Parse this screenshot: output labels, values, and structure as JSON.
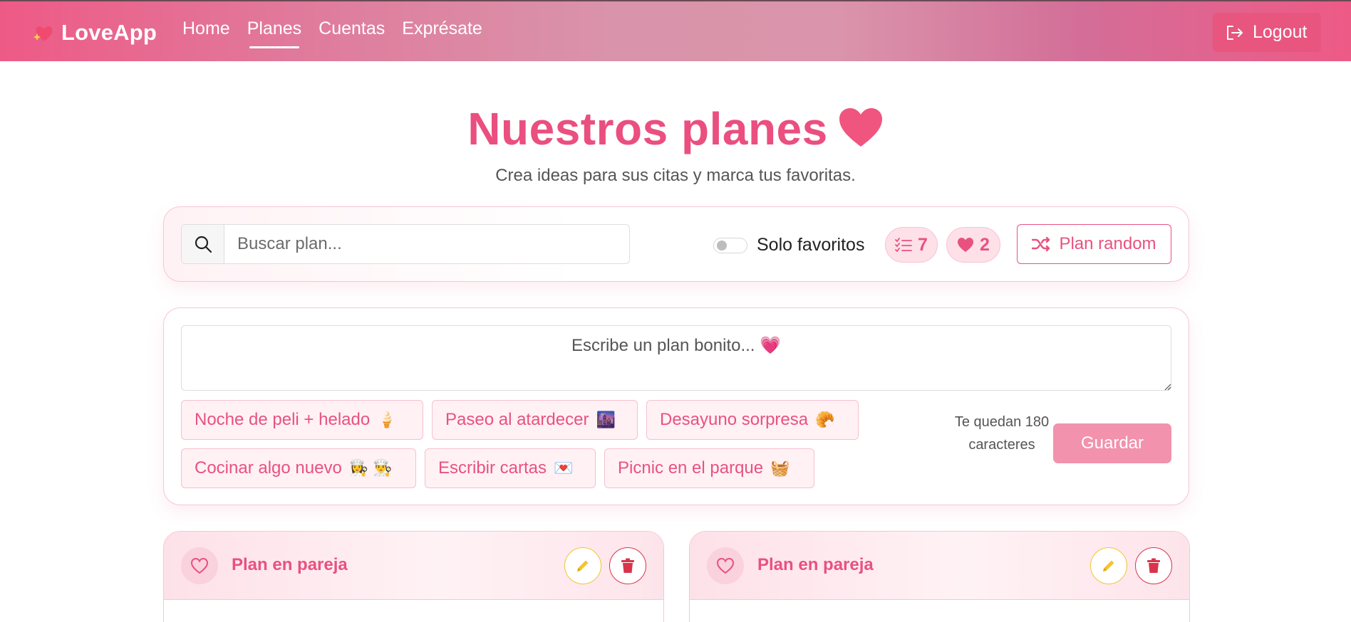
{
  "nav": {
    "brand": "LoveApp",
    "links": [
      "Home",
      "Planes",
      "Cuentas",
      "Exprésate"
    ],
    "active_link": "Planes",
    "logout_label": "Logout"
  },
  "header": {
    "title": "Nuestros planes",
    "subtitle": "Crea ideas para sus citas y marca tus favoritas."
  },
  "filters": {
    "search_placeholder": "Buscar plan...",
    "favorites_toggle_label": "Solo favoritos",
    "favorites_toggle_on": false,
    "plan_count": "7",
    "favorite_count": "2",
    "random_label": "Plan random"
  },
  "composer": {
    "placeholder": "Escribe un plan bonito... 💗",
    "suggestions": [
      {
        "label": "Noche de peli + helado",
        "emoji": "🍦"
      },
      {
        "label": "Paseo al atardecer",
        "emoji": "🌆"
      },
      {
        "label": "Desayuno sorpresa",
        "emoji": "🥐"
      },
      {
        "label": "Cocinar algo nuevo",
        "emoji": "👩‍🍳 👨‍🍳"
      },
      {
        "label": "Escribir cartas",
        "emoji": "💌"
      },
      {
        "label": "Picnic en el parque",
        "emoji": "🧺"
      }
    ],
    "remaining_text": "Te quedan 180 caracteres",
    "save_label": "Guardar"
  },
  "plans": [
    {
      "title": "Plan en pareja"
    },
    {
      "title": "Plan en pareja"
    }
  ],
  "colors": {
    "accent": "#e8527f",
    "title": "#ea4f7f",
    "edit": "#f4c430",
    "delete": "#d9344b"
  }
}
